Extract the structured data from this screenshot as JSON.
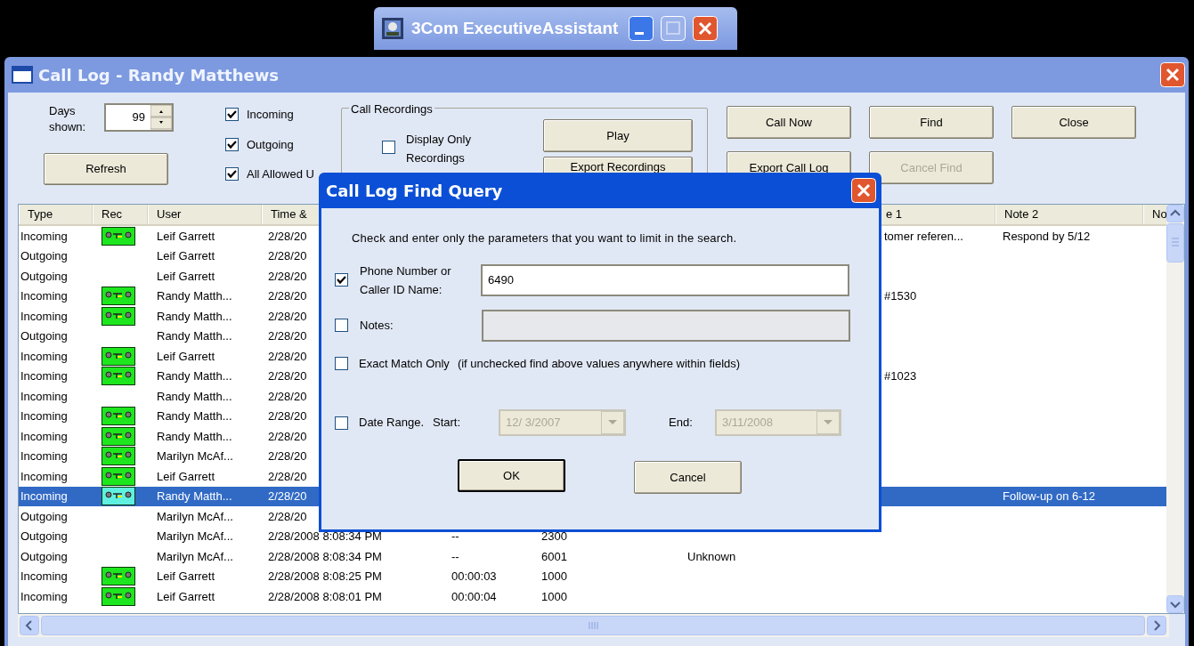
{
  "app_window": {
    "title": "3Com ExecutiveAssistant",
    "maximize_disabled": true
  },
  "window": {
    "title": "Call Log - Randy Matthews"
  },
  "days": {
    "label": "Days shown:",
    "value": "99"
  },
  "refresh_button": "Refresh",
  "filters": [
    {
      "label": "Incoming",
      "checked": true
    },
    {
      "label": "Outgoing",
      "checked": true
    },
    {
      "label": "All Allowed U",
      "checked": true
    }
  ],
  "recordings": {
    "title": "Call Recordings",
    "checkbox": {
      "label": "Display Only Recordings",
      "checked": false
    },
    "buttons": [
      "Play",
      "Export Recordings"
    ]
  },
  "buttons": [
    {
      "label": "Call Now",
      "disabled": false
    },
    {
      "label": "Find",
      "disabled": false
    },
    {
      "label": "Close",
      "disabled": false
    },
    {
      "label": "Export Call Log",
      "disabled": false
    },
    {
      "label": "Cancel Find",
      "disabled": true
    }
  ],
  "table": {
    "columns": [
      "Type",
      "Rec",
      "User",
      "Time &",
      "e 1",
      "Note 2",
      "No"
    ],
    "rows": [
      {
        "type": "Incoming",
        "recording": true,
        "user": "Leif Garrett",
        "time": "2/28/20",
        "note_1": "tomer referen...",
        "note_2": "Respond by 5/12",
        "selected": false
      },
      {
        "type": "Outgoing",
        "recording": false,
        "user": "Leif Garrett",
        "time": "2/28/20",
        "selected": false
      },
      {
        "type": "Outgoing",
        "recording": false,
        "user": "Leif Garrett",
        "time": "2/28/20",
        "selected": false
      },
      {
        "type": "Incoming",
        "recording": true,
        "user": "Randy Matth...",
        "time": "2/28/20",
        "note_1": "#1530",
        "selected": false
      },
      {
        "type": "Incoming",
        "recording": true,
        "user": "Randy Matth...",
        "time": "2/28/20",
        "selected": false
      },
      {
        "type": "Outgoing",
        "recording": false,
        "user": "Randy Matth...",
        "time": "2/28/20",
        "selected": false
      },
      {
        "type": "Incoming",
        "recording": true,
        "user": "Leif Garrett",
        "time": "2/28/20",
        "selected": false
      },
      {
        "type": "Incoming",
        "recording": true,
        "user": "Randy Matth...",
        "time": "2/28/20",
        "note_1": "#1023",
        "selected": false
      },
      {
        "type": "Incoming",
        "recording": false,
        "user": "Randy Matth...",
        "time": "2/28/20",
        "selected": false
      },
      {
        "type": "Incoming",
        "recording": true,
        "user": "Randy Matth...",
        "time": "2/28/20",
        "selected": false
      },
      {
        "type": "Incoming",
        "recording": true,
        "user": "Randy Matth...",
        "time": "2/28/20",
        "selected": false
      },
      {
        "type": "Incoming",
        "recording": true,
        "user": "Marilyn McAf...",
        "time": "2/28/20",
        "selected": false
      },
      {
        "type": "Incoming",
        "recording": true,
        "user": "Leif Garrett",
        "time": "2/28/20",
        "selected": false
      },
      {
        "type": "Incoming",
        "recording": true,
        "user": "Randy Matth...",
        "time": "2/28/20",
        "note_2": "Follow-up on 6-12",
        "selected": true
      },
      {
        "type": "Outgoing",
        "recording": false,
        "user": "Marilyn McAf...",
        "time": "2/28/20",
        "selected": false
      },
      {
        "type": "Outgoing",
        "recording": false,
        "user": "Marilyn McAf...",
        "time": "2/28/2008 8:08:34 PM",
        "duration": "--",
        "number": "2300",
        "selected": false
      },
      {
        "type": "Outgoing",
        "recording": false,
        "user": "Marilyn McAf...",
        "time": "2/28/2008 8:08:34 PM",
        "duration": "--",
        "number": "6001",
        "caller_id": "Unknown",
        "selected": false
      },
      {
        "type": "Incoming",
        "recording": true,
        "user": "Leif Garrett",
        "time": "2/28/2008 8:08:25 PM",
        "duration": "00:00:03",
        "number": "1000",
        "selected": false
      },
      {
        "type": "Incoming",
        "recording": true,
        "user": "Leif Garrett",
        "time": "2/28/2008 8:08:01 PM",
        "duration": "00:00:04",
        "number": "1000",
        "selected": false
      }
    ]
  },
  "dialog": {
    "title": "Call Log Find Query",
    "instruction": "Check and enter only the parameters that you want to limit in the search.",
    "phone": {
      "label": "Phone Number or Caller ID Name:",
      "checked": true,
      "value": "6490"
    },
    "notes": {
      "label": "Notes:",
      "checked": false,
      "disabled": true
    },
    "exact": {
      "label": "Exact Match Only",
      "hint": "(if unchecked find above values anywhere within fields)",
      "checked": false
    },
    "date_range": {
      "label": "Date Range.",
      "checked": false,
      "disabled": true,
      "start_label": "Start:",
      "start": "12/ 3/2007",
      "end_label": "End:",
      "end": "3/11/2008"
    },
    "buttons": [
      {
        "label": "OK",
        "default": true
      },
      {
        "label": "Cancel",
        "default": false
      }
    ]
  }
}
